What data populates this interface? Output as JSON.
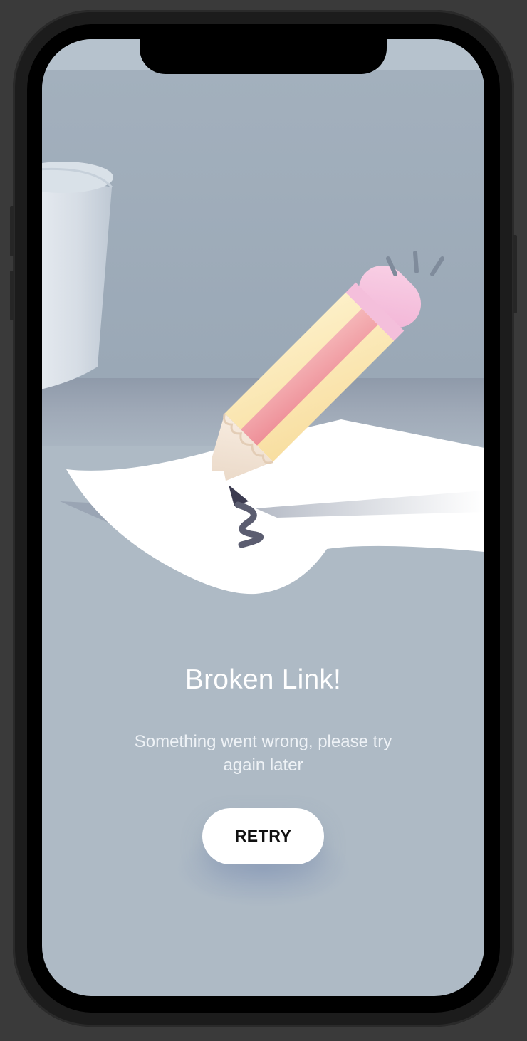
{
  "error_screen": {
    "title": "Broken Link!",
    "message": "Something went wrong, please try again later",
    "retry_label": "RETRY"
  },
  "colors": {
    "background": "#aebac5",
    "wall": "#9fadba",
    "pencil_body": "#fbe6b4",
    "pencil_stripe": "#f2a0a8",
    "eraser": "#f7c4de",
    "paper": "#ffffff",
    "button": "#ffffff",
    "button_text": "#111111"
  },
  "icons": {
    "illustration": "broken-pencil-illustration"
  }
}
